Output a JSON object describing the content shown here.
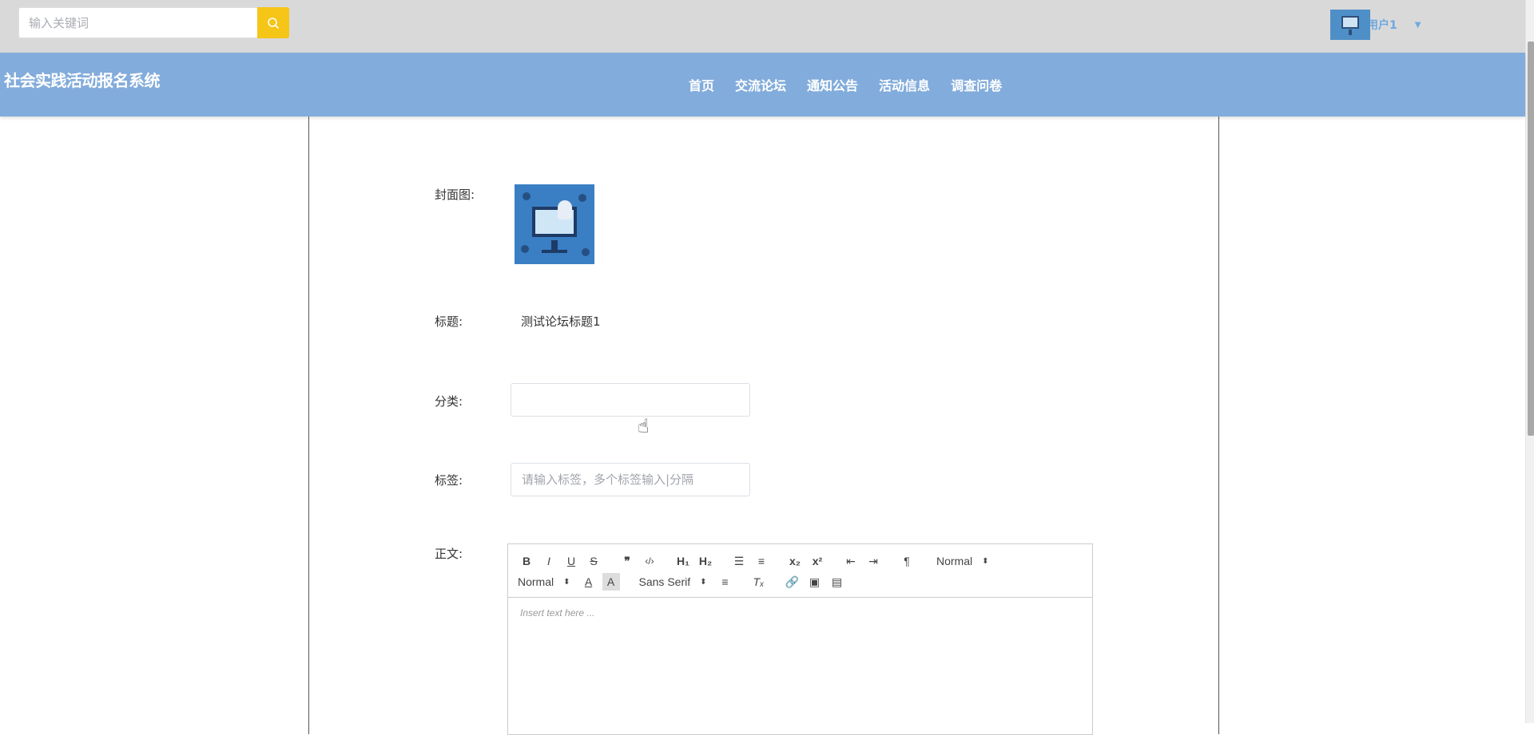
{
  "search": {
    "placeholder": "输入关键词"
  },
  "user": {
    "name": "用户1"
  },
  "brand": {
    "title": "社会实践活动报名系统"
  },
  "nav": {
    "items": [
      "首页",
      "交流论坛",
      "通知公告",
      "活动信息",
      "调查问卷"
    ]
  },
  "form": {
    "cover_label": "封面图:",
    "title_label": "标题:",
    "title_value": "测试论坛标题1",
    "category_label": "分类:",
    "category_value": "",
    "tags_label": "标签:",
    "tags_placeholder": "请输入标签，多个标签输入|分隔",
    "content_label": "正文:"
  },
  "editor": {
    "header_select": "Normal",
    "size_select": "Normal",
    "font_select": "Sans Serif",
    "placeholder": "Insert text here ...",
    "buttons": [
      "bold",
      "italic",
      "underline",
      "strike",
      "blockquote",
      "code-block",
      "header-1",
      "header-2",
      "ordered-list",
      "bullet-list",
      "subscript",
      "superscript",
      "outdent",
      "indent",
      "direction",
      "color",
      "background",
      "align",
      "clean",
      "link",
      "image",
      "video"
    ]
  },
  "colors": {
    "topbar": "#d9d9d9",
    "navbar": "#82acdb",
    "search_button": "#f5c518",
    "user_name": "#6fa8e0"
  }
}
